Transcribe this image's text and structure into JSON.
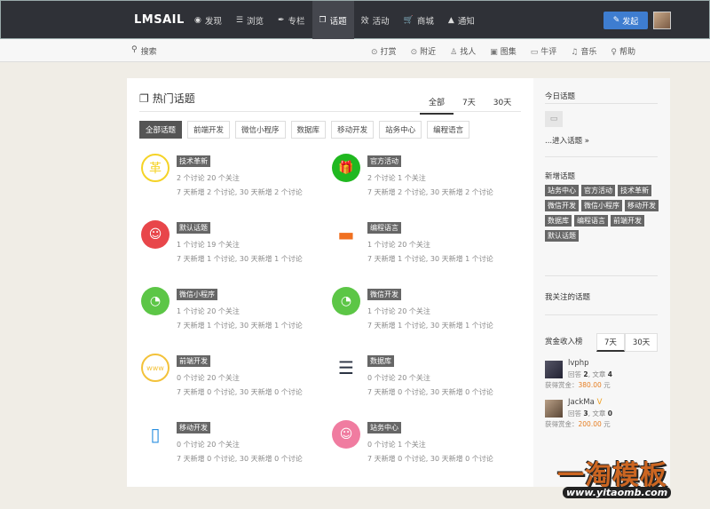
{
  "header": {
    "logo": "LMSAIL",
    "nav": [
      {
        "label": "发现",
        "icon": "eye-icon",
        "glyph": "◉"
      },
      {
        "label": "浏览",
        "icon": "list-icon",
        "glyph": "☰"
      },
      {
        "label": "专栏",
        "icon": "feather-icon",
        "glyph": "✒"
      },
      {
        "label": "话题",
        "icon": "topic-icon",
        "glyph": "❐"
      },
      {
        "label": "活动",
        "icon": "activity-icon",
        "glyph": "效"
      },
      {
        "label": "商城",
        "icon": "cart-icon",
        "glyph": "🛒"
      },
      {
        "label": "通知",
        "icon": "bell-icon",
        "glyph": "▲"
      }
    ],
    "post_button": "发起"
  },
  "subbar": {
    "search": "搜索",
    "links": [
      {
        "label": "打赏",
        "glyph": "⊙"
      },
      {
        "label": "附近",
        "glyph": "⊙"
      },
      {
        "label": "找人",
        "glyph": "♙"
      },
      {
        "label": "图集",
        "glyph": "▣"
      },
      {
        "label": "牛评",
        "glyph": "▭"
      },
      {
        "label": "音乐",
        "glyph": "♫"
      },
      {
        "label": "帮助",
        "glyph": "♀"
      }
    ]
  },
  "main": {
    "title": "热门话题",
    "range_tabs": [
      "全部",
      "7天",
      "30天"
    ],
    "categories": [
      "全部话题",
      "前端开发",
      "微信小程序",
      "数据库",
      "移动开发",
      "站务中心",
      "编程语言"
    ],
    "topics": [
      {
        "tag": "技术革新",
        "stat": "2 个讨论 20 个关注",
        "week": "7 天新增 2 个讨论, 30 天新增 2 个讨论",
        "glyph": "革",
        "color": "#f5d327"
      },
      {
        "tag": "官方活动",
        "stat": "2 个讨论 1 个关注",
        "week": "7 天新增 2 个讨论, 30 天新增 2 个讨论",
        "glyph": "🎁",
        "color": "#20b820"
      },
      {
        "tag": "默认话题",
        "stat": "1 个讨论 19 个关注",
        "week": "7 天新增 1 个讨论, 30 天新增 1 个讨论",
        "glyph": "☺",
        "color": "#e8464a"
      },
      {
        "tag": "编程语言",
        "stat": "1 个讨论 20 个关注",
        "week": "7 天新增 1 个讨论, 30 天新增 1 个讨论",
        "glyph": "▬",
        "color": "#f07020"
      },
      {
        "tag": "微信小程序",
        "stat": "1 个讨论 20 个关注",
        "week": "7 天新增 1 个讨论, 30 天新增 1 个讨论",
        "glyph": "◔",
        "color": "#5cc646"
      },
      {
        "tag": "微信开发",
        "stat": "1 个讨论 20 个关注",
        "week": "7 天新增 1 个讨论, 30 天新增 1 个讨论",
        "glyph": "◔",
        "color": "#5cc646"
      },
      {
        "tag": "前端开发",
        "stat": "0 个讨论 20 个关注",
        "week": "7 天新增 0 个讨论, 30 天新增 0 个讨论",
        "glyph": "www",
        "color": "#f3c23a"
      },
      {
        "tag": "数据库",
        "stat": "0 个讨论 20 个关注",
        "week": "7 天新增 0 个讨论, 30 天新增 0 个讨论",
        "glyph": "☰",
        "color": "#2c3444"
      },
      {
        "tag": "移动开发",
        "stat": "0 个讨论 20 个关注",
        "week": "7 天新增 0 个讨论, 30 天新增 0 个讨论",
        "glyph": "▯",
        "color": "#2a8fe0"
      },
      {
        "tag": "站务中心",
        "stat": "0 个讨论 1 个关注",
        "week": "7 天新增 0 个讨论, 30 天新增 0 个讨论",
        "glyph": "☺",
        "color": "#f07ca0"
      }
    ]
  },
  "side": {
    "today_title": "今日话题",
    "enter_link": "...进入话题 »",
    "new_title": "新增话题",
    "new_tags": [
      "站务中心",
      "官方活动",
      "技术革新",
      "微信开发",
      "微信小程序",
      "移动开发",
      "数据库",
      "编程语言",
      "前端开发",
      "默认话题"
    ],
    "follow_title": "我关注的话题",
    "rank_title": "赏金收入榜",
    "rank_tabs": [
      "7天",
      "30天"
    ],
    "users": [
      {
        "name": "lvphp",
        "stat_prefix": "回答",
        "answers": "2",
        "stat_mid": ", 文章",
        "articles": "4",
        "reward_label": "获得赏金：",
        "reward": "380.00",
        "unit": "元"
      },
      {
        "name": "JackMa",
        "stat_prefix": "回答",
        "answers": "3",
        "stat_mid": ", 文章",
        "articles": "0",
        "reward_label": "获得赏金：",
        "reward": "200.00",
        "unit": "元"
      }
    ]
  },
  "watermark": {
    "cn": "一淘模板",
    "url": "www.yitaomb.com"
  }
}
